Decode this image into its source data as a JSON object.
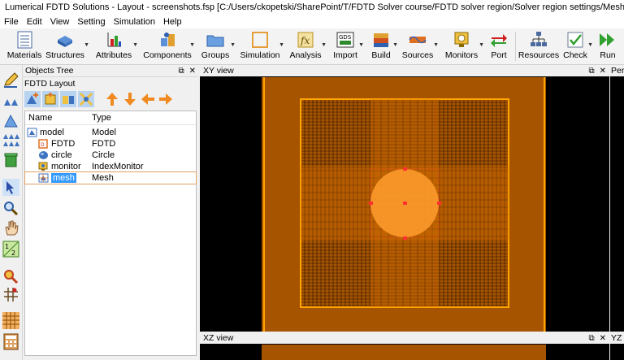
{
  "window": {
    "title": "Lumerical FDTD Solutions - Layout - screenshots.fsp [C:/Users/ckopetski/SharePoint/T/FDTD Solver course/FDTD solver region/Solver region settings/Mesh override regions/"
  },
  "menu": [
    "File",
    "Edit",
    "View",
    "Setting",
    "Simulation",
    "Help"
  ],
  "toolbar": [
    {
      "label": "Materials",
      "icon": "materials-icon"
    },
    {
      "label": "Structures",
      "icon": "structures-icon"
    },
    {
      "label": "Attributes",
      "icon": "attributes-icon"
    },
    {
      "label": "Components",
      "icon": "components-icon"
    },
    {
      "label": "Groups",
      "icon": "groups-icon"
    },
    {
      "label": "Simulation",
      "icon": "simulation-icon"
    },
    {
      "label": "Analysis",
      "icon": "analysis-icon"
    },
    {
      "label": "Import",
      "icon": "gds-import-icon"
    },
    {
      "label": "Build",
      "icon": "build-icon"
    },
    {
      "label": "Sources",
      "icon": "sources-icon"
    },
    {
      "label": "Monitors",
      "icon": "monitors-icon"
    },
    {
      "label": "Port",
      "icon": "port-icon"
    },
    {
      "label": "Resources",
      "icon": "resources-icon"
    },
    {
      "label": "Check",
      "icon": "check-icon"
    },
    {
      "label": "Run",
      "icon": "run-icon"
    }
  ],
  "objects_panel": {
    "title": "Objects Tree",
    "layout_label": "FDTD Layout",
    "columns": {
      "name": "Name",
      "type": "Type"
    },
    "rows": [
      {
        "name": "model",
        "type": "Model",
        "icon": "model-icon",
        "selected": false
      },
      {
        "name": "FDTD",
        "type": "FDTD",
        "icon": "fdtd-icon",
        "selected": false
      },
      {
        "name": "circle",
        "type": "Circle",
        "icon": "circle-icon",
        "selected": false
      },
      {
        "name": "monitor",
        "type": "IndexMonitor",
        "icon": "monitor-icon",
        "selected": false
      },
      {
        "name": "mesh",
        "type": "Mesh",
        "icon": "mesh-icon",
        "selected": true
      }
    ]
  },
  "views": {
    "xy": "XY view",
    "xz": "XZ view",
    "perspective": "Pers",
    "yz": "YZ"
  },
  "colors": {
    "sim_region": "#a65400",
    "fdtd_border": "#ffa500",
    "circle": "#ff9d2e",
    "mesh_override": "#d46e00"
  }
}
